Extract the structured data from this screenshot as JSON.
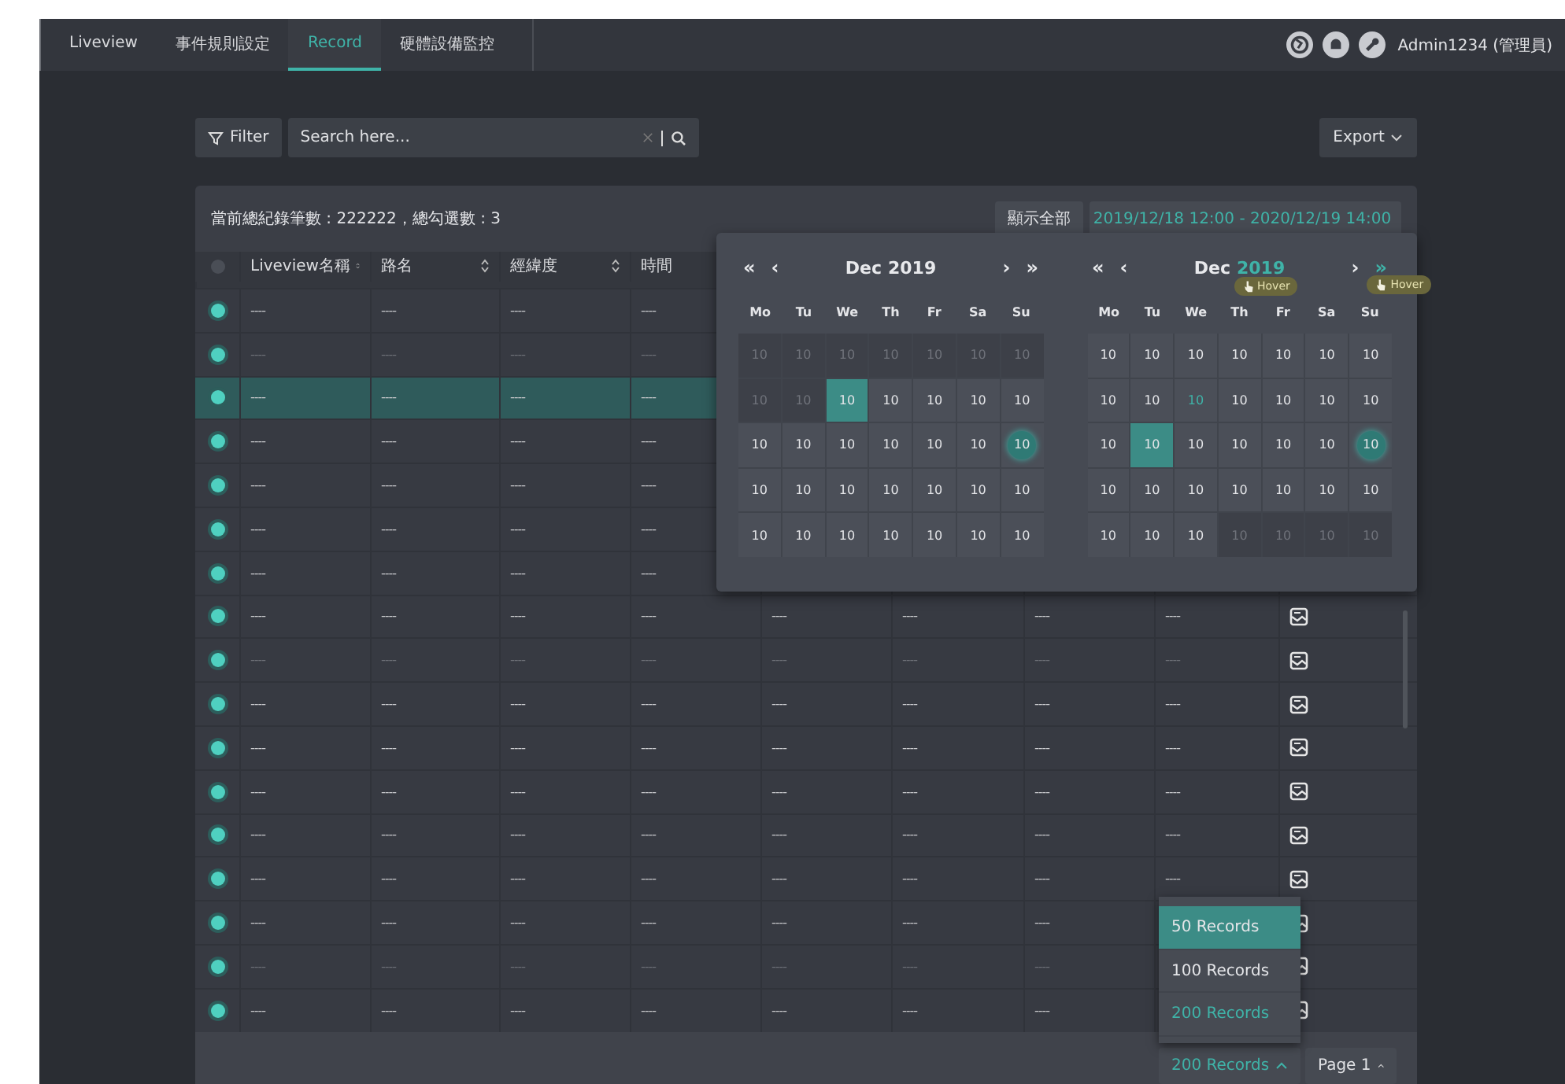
{
  "nav": {
    "tabs": [
      {
        "label": "Liveview",
        "selected": false
      },
      {
        "label": "事件規則設定",
        "selected": false
      },
      {
        "label": "Record",
        "selected": true
      },
      {
        "label": "硬體設備監控",
        "selected": false
      }
    ],
    "user": "Admin1234 (管理員)"
  },
  "toolbar": {
    "filter": "Filter",
    "search": {
      "placeholder": "Search here..."
    },
    "export": "Export"
  },
  "summary": "當前總紀錄筆數 : 222222，總勾選數 : 3",
  "show_all": "顯示全部",
  "date_range": "2019/12/18 12:00 - 2020/12/19 14:00",
  "table": {
    "header_checked": false,
    "columns": [
      {
        "label": "Liveview名稱",
        "sortable": true
      },
      {
        "label": "路名",
        "sortable": true
      },
      {
        "label": "經緯度",
        "sortable": true
      },
      {
        "label": "時間"
      }
    ],
    "rows": [
      {
        "checked": true,
        "selected": false,
        "disabled": false,
        "cells": [
          "----",
          "----",
          "----",
          "----"
        ]
      },
      {
        "checked": true,
        "selected": false,
        "disabled": true,
        "cells": [
          "----",
          "----",
          "----",
          "----"
        ]
      },
      {
        "checked": true,
        "selected": true,
        "disabled": false,
        "cells": [
          "----",
          "----",
          "----",
          "----"
        ]
      },
      {
        "checked": true,
        "selected": false,
        "disabled": false,
        "cells": [
          "----",
          "----",
          "----",
          "----"
        ]
      },
      {
        "checked": true,
        "selected": false,
        "disabled": false,
        "cells": [
          "----",
          "----",
          "----",
          "----"
        ]
      },
      {
        "checked": true,
        "selected": false,
        "disabled": false,
        "cells": [
          "----",
          "----",
          "----",
          "----"
        ]
      },
      {
        "checked": true,
        "selected": false,
        "disabled": false,
        "cells": [
          "----",
          "----",
          "----",
          "----"
        ]
      },
      {
        "checked": true,
        "selected": false,
        "disabled": false,
        "cells": [
          "----",
          "----",
          "----",
          "----",
          "----",
          "----",
          "----",
          "----"
        ],
        "snapshot": true
      },
      {
        "checked": true,
        "selected": false,
        "disabled": true,
        "cells": [
          "----",
          "----",
          "----",
          "----",
          "----",
          "----",
          "----",
          "----"
        ],
        "snapshot": true
      },
      {
        "checked": true,
        "selected": false,
        "disabled": false,
        "cells": [
          "----",
          "----",
          "----",
          "----",
          "----",
          "----",
          "----",
          "----"
        ],
        "snapshot": true
      },
      {
        "checked": true,
        "selected": false,
        "disabled": false,
        "cells": [
          "----",
          "----",
          "----",
          "----",
          "----",
          "----",
          "----",
          "----"
        ],
        "snapshot": true
      },
      {
        "checked": true,
        "selected": false,
        "disabled": false,
        "cells": [
          "----",
          "----",
          "----",
          "----",
          "----",
          "----",
          "----",
          "----"
        ],
        "snapshot": true
      },
      {
        "checked": true,
        "selected": false,
        "disabled": false,
        "cells": [
          "----",
          "----",
          "----",
          "----",
          "----",
          "----",
          "----",
          "----"
        ],
        "snapshot": true
      },
      {
        "checked": true,
        "selected": false,
        "disabled": false,
        "cells": [
          "----",
          "----",
          "----",
          "----",
          "----",
          "----",
          "----",
          "----"
        ],
        "snapshot": true
      },
      {
        "checked": true,
        "selected": false,
        "disabled": false,
        "cells": [
          "----",
          "----",
          "----",
          "----",
          "----",
          "----",
          "----"
        ],
        "snapshot": true
      },
      {
        "checked": true,
        "selected": false,
        "disabled": true,
        "cells": [
          "----",
          "----",
          "----",
          "----",
          "----",
          "----",
          "----"
        ],
        "snapshot": true
      },
      {
        "checked": true,
        "selected": false,
        "disabled": false,
        "cells": [
          "----",
          "----",
          "----",
          "----",
          "----",
          "----",
          "----"
        ],
        "snapshot": true
      }
    ]
  },
  "calendar": {
    "panels": [
      {
        "month": "Dec",
        "year": "2019",
        "year_hover": false,
        "prev": [
          {
            "symbol": "«",
            "hover": false
          },
          {
            "symbol": "‹",
            "hover": false
          }
        ],
        "next": [
          {
            "symbol": "›",
            "hover": false
          },
          {
            "symbol": "»",
            "hover": false
          }
        ],
        "weekdays": [
          "Mo",
          "Tu",
          "We",
          "Th",
          "Fr",
          "Sa",
          "Su"
        ],
        "weeks": [
          [
            {
              "text": "10",
              "kind": "out"
            },
            {
              "text": "10",
              "kind": "out"
            },
            {
              "text": "10",
              "kind": "out"
            },
            {
              "text": "10",
              "kind": "out"
            },
            {
              "text": "10",
              "kind": "out"
            },
            {
              "text": "10",
              "kind": "out"
            },
            {
              "text": "10",
              "kind": "out"
            }
          ],
          [
            {
              "text": "10",
              "kind": "out"
            },
            {
              "text": "10",
              "kind": "out"
            },
            {
              "text": "10",
              "kind": "selected"
            },
            {
              "text": "10",
              "kind": "in"
            },
            {
              "text": "10",
              "kind": "in"
            },
            {
              "text": "10",
              "kind": "in"
            },
            {
              "text": "10",
              "kind": "in"
            }
          ],
          [
            {
              "text": "10",
              "kind": "in"
            },
            {
              "text": "10",
              "kind": "in"
            },
            {
              "text": "10",
              "kind": "in"
            },
            {
              "text": "10",
              "kind": "in"
            },
            {
              "text": "10",
              "kind": "in"
            },
            {
              "text": "10",
              "kind": "in"
            },
            {
              "text": "10",
              "kind": "today"
            }
          ],
          [
            {
              "text": "10",
              "kind": "in"
            },
            {
              "text": "10",
              "kind": "in"
            },
            {
              "text": "10",
              "kind": "in"
            },
            {
              "text": "10",
              "kind": "in"
            },
            {
              "text": "10",
              "kind": "in"
            },
            {
              "text": "10",
              "kind": "in"
            },
            {
              "text": "10",
              "kind": "in"
            }
          ],
          [
            {
              "text": "10",
              "kind": "in"
            },
            {
              "text": "10",
              "kind": "in"
            },
            {
              "text": "10",
              "kind": "in"
            },
            {
              "text": "10",
              "kind": "in"
            },
            {
              "text": "10",
              "kind": "in"
            },
            {
              "text": "10",
              "kind": "in"
            },
            {
              "text": "10",
              "kind": "in"
            }
          ]
        ]
      },
      {
        "month": "Dec",
        "year": "2019",
        "year_hover": true,
        "year_tooltip": "Hover",
        "prev": [
          {
            "symbol": "«",
            "hover": false
          },
          {
            "symbol": "‹",
            "hover": false
          }
        ],
        "next": [
          {
            "symbol": "›",
            "hover": false
          },
          {
            "symbol": "»",
            "hover": true,
            "tooltip": "Hover"
          }
        ],
        "weekdays": [
          "Mo",
          "Tu",
          "We",
          "Th",
          "Fr",
          "Sa",
          "Su"
        ],
        "weeks": [
          [
            {
              "text": "10",
              "kind": "in"
            },
            {
              "text": "10",
              "kind": "in"
            },
            {
              "text": "10",
              "kind": "in"
            },
            {
              "text": "10",
              "kind": "in"
            },
            {
              "text": "10",
              "kind": "in"
            },
            {
              "text": "10",
              "kind": "in"
            },
            {
              "text": "10",
              "kind": "in"
            }
          ],
          [
            {
              "text": "10",
              "kind": "in"
            },
            {
              "text": "10",
              "kind": "in"
            },
            {
              "text": "10",
              "kind": "hover"
            },
            {
              "text": "10",
              "kind": "in"
            },
            {
              "text": "10",
              "kind": "in"
            },
            {
              "text": "10",
              "kind": "in"
            },
            {
              "text": "10",
              "kind": "in"
            }
          ],
          [
            {
              "text": "10",
              "kind": "in"
            },
            {
              "text": "10",
              "kind": "selected"
            },
            {
              "text": "10",
              "kind": "in"
            },
            {
              "text": "10",
              "kind": "in"
            },
            {
              "text": "10",
              "kind": "in"
            },
            {
              "text": "10",
              "kind": "in"
            },
            {
              "text": "10",
              "kind": "today"
            }
          ],
          [
            {
              "text": "10",
              "kind": "in"
            },
            {
              "text": "10",
              "kind": "in"
            },
            {
              "text": "10",
              "kind": "in"
            },
            {
              "text": "10",
              "kind": "in"
            },
            {
              "text": "10",
              "kind": "in"
            },
            {
              "text": "10",
              "kind": "in"
            },
            {
              "text": "10",
              "kind": "in"
            }
          ],
          [
            {
              "text": "10",
              "kind": "in"
            },
            {
              "text": "10",
              "kind": "in"
            },
            {
              "text": "10",
              "kind": "in"
            },
            {
              "text": "10",
              "kind": "out"
            },
            {
              "text": "10",
              "kind": "out"
            },
            {
              "text": "10",
              "kind": "out"
            },
            {
              "text": "10",
              "kind": "out"
            }
          ]
        ]
      }
    ]
  },
  "pager": {
    "size": {
      "label": "200 Records",
      "open": true,
      "options": [
        {
          "label": "50 Records",
          "hovered": true,
          "selected": false
        },
        {
          "label": "100 Records",
          "hovered": false,
          "selected": false
        },
        {
          "label": "200 Records",
          "hovered": false,
          "selected": true
        }
      ]
    },
    "page": "Page 1"
  }
}
